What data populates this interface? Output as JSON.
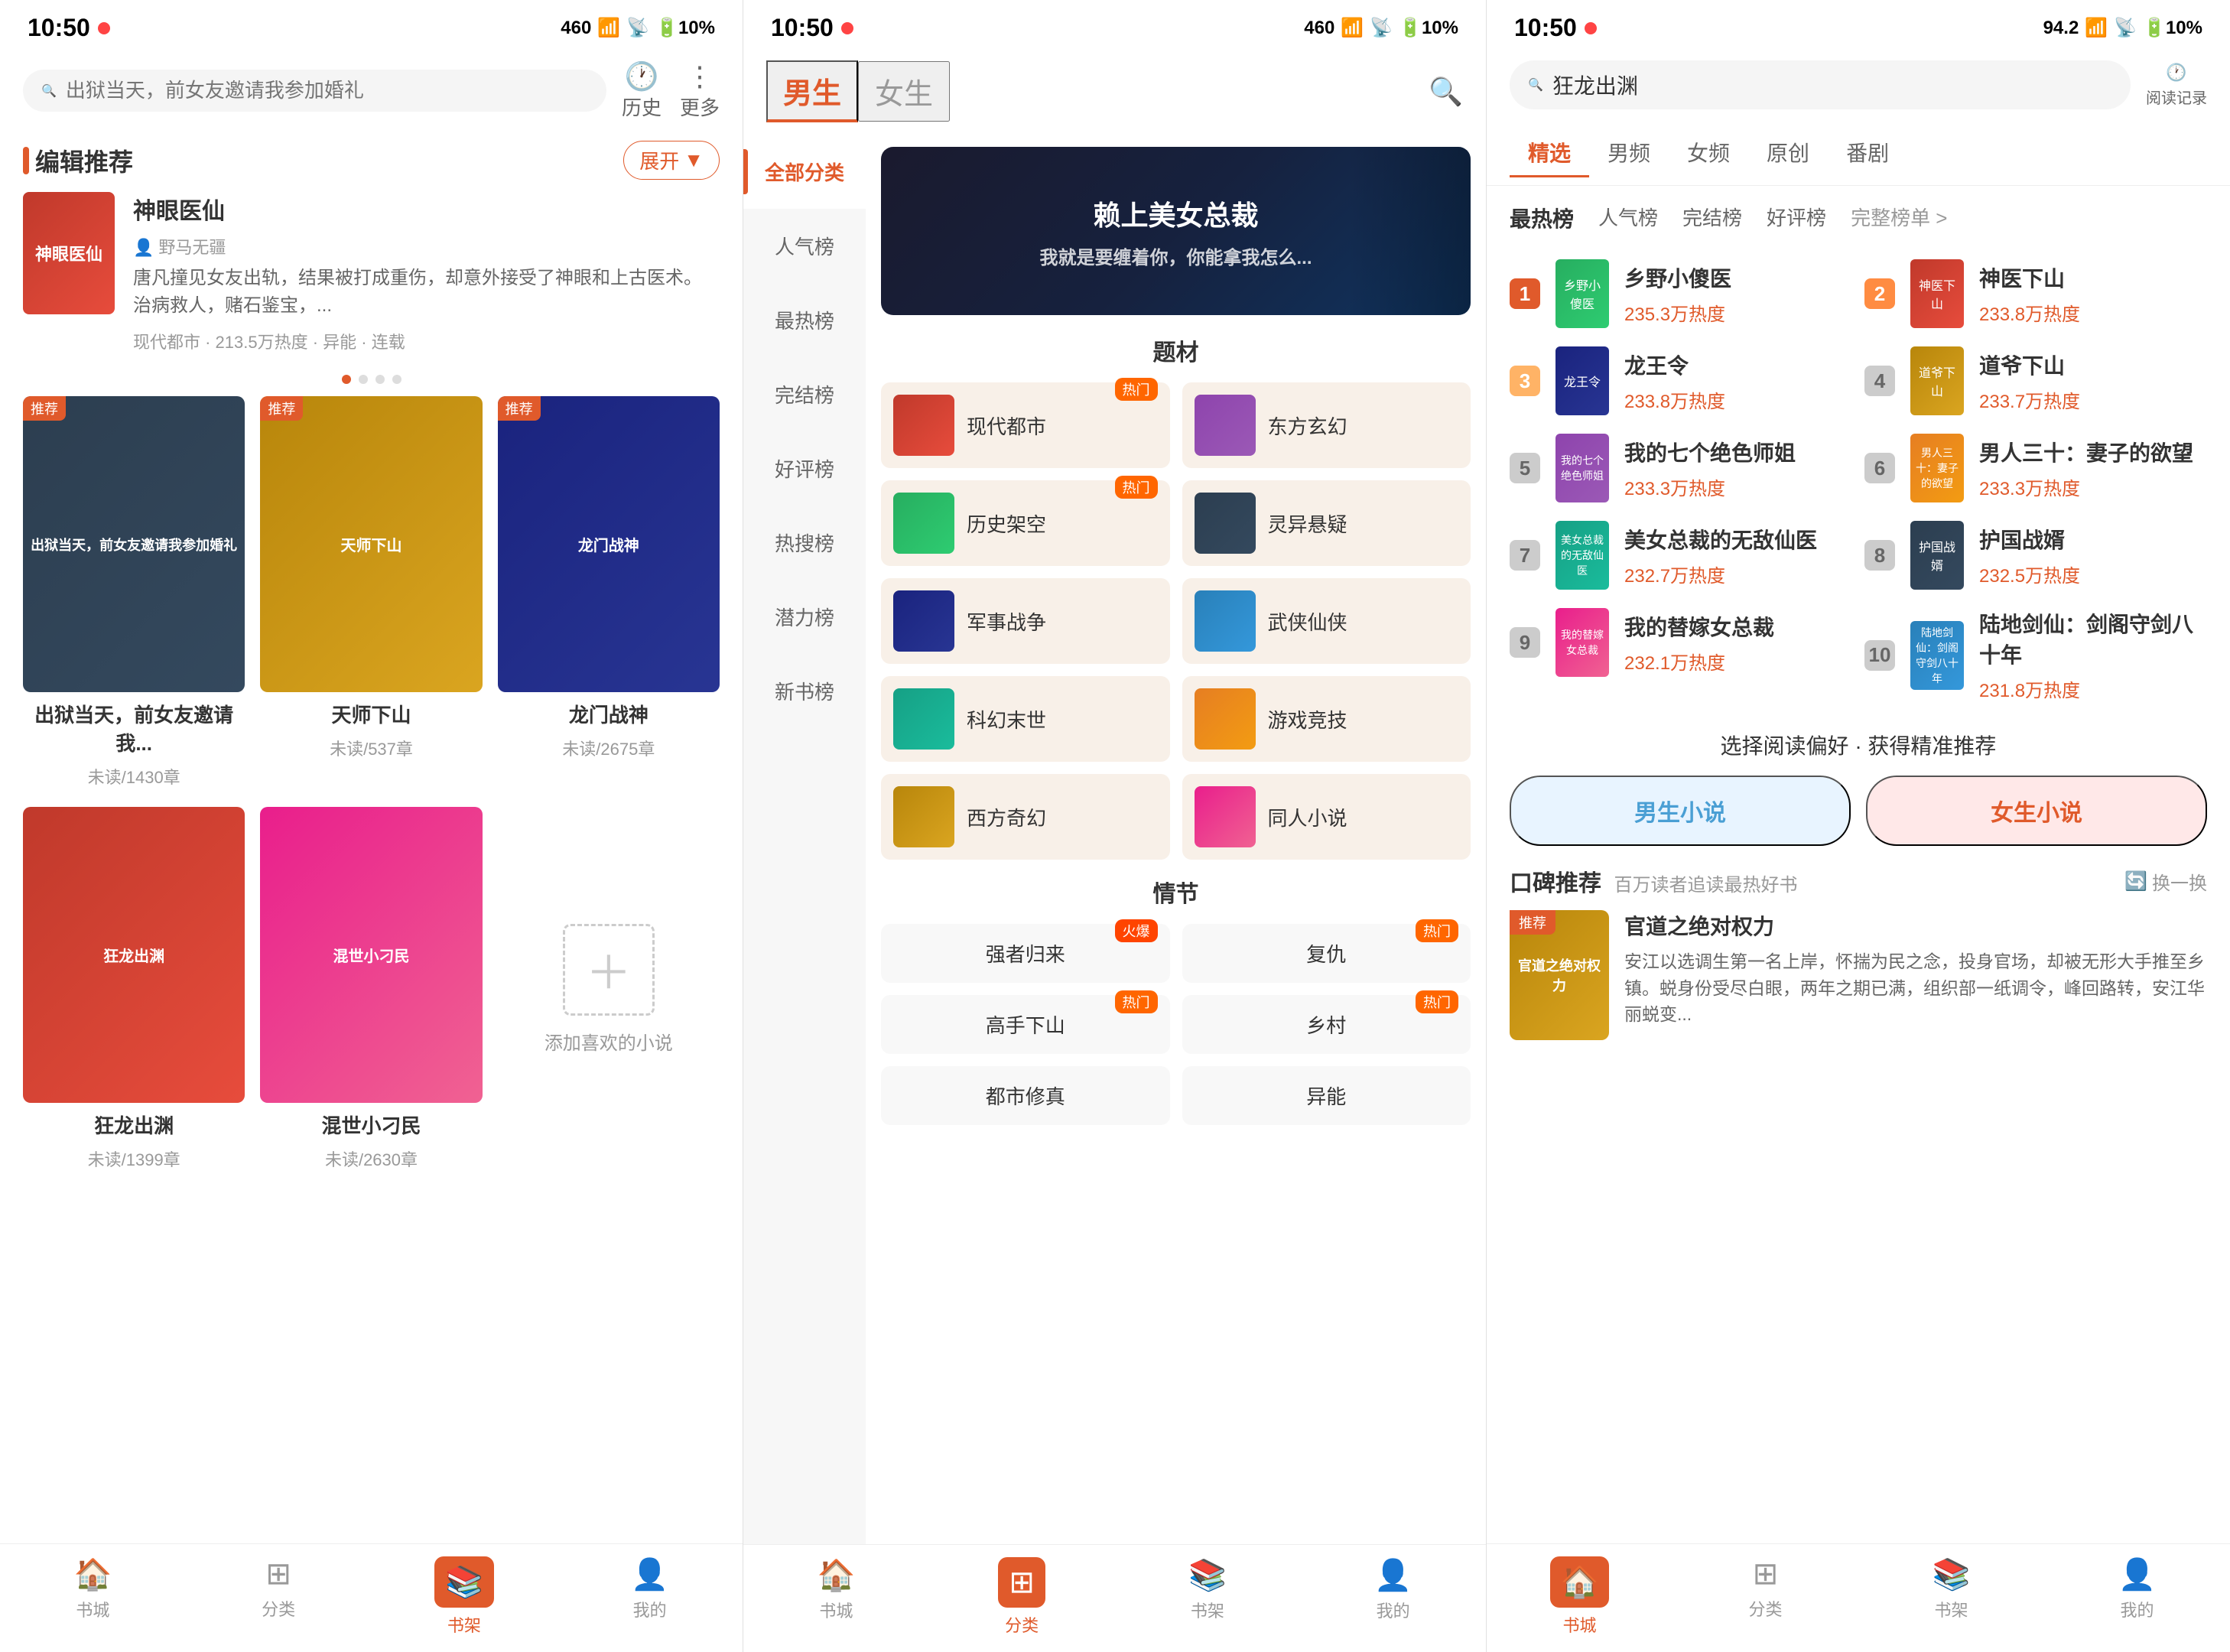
{
  "screens": [
    {
      "id": "screen1",
      "statusBar": {
        "time": "10:50",
        "dot": true
      },
      "search": {
        "placeholder": "出狱当天，前女友邀请我参加婚礼",
        "historyLabel": "历史",
        "moreLabel": "更多"
      },
      "editorRecommend": {
        "title": "编辑推荐",
        "expandLabel": "展开",
        "featuredBook": {
          "title": "神眼医仙",
          "tag": "野马无疆",
          "desc": "唐凡撞见女友出轨，结果被打成重伤，却意外接受了神眼和上古医术。治病救人，赌石鉴宝，...",
          "genre": "现代都市 · 213.5万热度 · 异能 · 连载"
        },
        "carouselBooks": [
          {
            "title": "出狱当天，前女友邀请我参加婚礼",
            "chapters": "未读/1430章",
            "coverClass": "cover-dark",
            "badge": "推荐"
          },
          {
            "title": "天师下山",
            "chapters": "未读/537章",
            "coverClass": "cover-gold",
            "badge": "推荐"
          },
          {
            "title": "龙门战神",
            "chapters": "未读/2675章",
            "coverClass": "cover-navy",
            "badge": "推荐"
          }
        ],
        "row2Books": [
          {
            "title": "狂龙出渊",
            "chapters": "未读/1399章",
            "coverClass": "cover-red",
            "badge": ""
          },
          {
            "title": "混世小刁民",
            "chapters": "未读/2630章",
            "coverClass": "cover-pink",
            "badge": ""
          }
        ],
        "addLabel": "添加喜欢的小说"
      },
      "nav": [
        {
          "icon": "🏠",
          "label": "书城",
          "active": false
        },
        {
          "icon": "⊞",
          "label": "分类",
          "active": false
        },
        {
          "icon": "📚",
          "label": "书架",
          "active": true
        },
        {
          "icon": "👤",
          "label": "我的",
          "active": false
        }
      ]
    },
    {
      "id": "screen2",
      "statusBar": {
        "time": "10:50",
        "dot": true
      },
      "tabs": [
        {
          "label": "男生",
          "active": true
        },
        {
          "label": "女生",
          "active": false
        }
      ],
      "sidebar": [
        {
          "label": "全部分类",
          "active": true
        },
        {
          "label": "人气榜",
          "active": false
        },
        {
          "label": "最热榜",
          "active": false
        },
        {
          "label": "完结榜",
          "active": false
        },
        {
          "label": "好评榜",
          "active": false
        },
        {
          "label": "热搜榜",
          "active": false
        },
        {
          "label": "潜力榜",
          "active": false
        },
        {
          "label": "新书榜",
          "active": false
        }
      ],
      "banner": {
        "text": "赖上美女总裁\n我就是要缠着你，你能拿我怎么..."
      },
      "categories": {
        "topicTitle": "题材",
        "items": [
          {
            "name": "现代都市",
            "hot": true,
            "coverClass": "cover-red"
          },
          {
            "name": "东方玄幻",
            "hot": false,
            "coverClass": "cover-purple"
          },
          {
            "name": "历史架空",
            "hot": true,
            "coverClass": "cover-green"
          },
          {
            "name": "灵异悬疑",
            "hot": false,
            "coverClass": "cover-dark"
          },
          {
            "name": "军事战争",
            "hot": false,
            "coverClass": "cover-navy"
          },
          {
            "name": "武侠仙侠",
            "hot": false,
            "coverClass": "cover-blue"
          },
          {
            "name": "科幻末世",
            "hot": false,
            "coverClass": "cover-teal"
          },
          {
            "name": "游戏竞技",
            "hot": false,
            "coverClass": "cover-orange"
          },
          {
            "name": "西方奇幻",
            "hot": false,
            "coverClass": "cover-gold"
          },
          {
            "name": "同人小说",
            "hot": false,
            "coverClass": "cover-pink"
          }
        ],
        "feelingTitle": "情节",
        "feelings": [
          {
            "name": "强者归来",
            "badge": "火爆"
          },
          {
            "name": "复仇",
            "badge": "热门"
          },
          {
            "name": "高手下山",
            "badge": "热门"
          },
          {
            "name": "乡村",
            "badge": "热门"
          },
          {
            "name": "都市修真",
            "badge": ""
          },
          {
            "name": "异能",
            "badge": ""
          }
        ]
      },
      "nav": [
        {
          "icon": "🏠",
          "label": "书城",
          "active": false
        },
        {
          "icon": "⊞",
          "label": "分类",
          "active": true
        },
        {
          "icon": "📚",
          "label": "书架",
          "active": false
        },
        {
          "icon": "👤",
          "label": "我的",
          "active": false
        }
      ]
    },
    {
      "id": "screen3",
      "statusBar": {
        "time": "10:50",
        "dot": true
      },
      "search": {
        "placeholder": "狂龙出渊",
        "historyLabel": "阅读记录"
      },
      "mainTabs": [
        {
          "label": "精选",
          "active": true
        },
        {
          "label": "男频",
          "active": false
        },
        {
          "label": "女频",
          "active": false
        },
        {
          "label": "原创",
          "active": false
        },
        {
          "label": "番剧",
          "active": false
        }
      ],
      "subTabs": [
        {
          "label": "最热榜",
          "active": true
        },
        {
          "label": "人气榜",
          "active": false
        },
        {
          "label": "完结榜",
          "active": false
        },
        {
          "label": "好评榜",
          "active": false
        },
        {
          "label": "完整榜单 >",
          "active": false,
          "special": true
        }
      ],
      "rankings": [
        {
          "rank": 1,
          "title": "乡野小傻医",
          "heat": "235.3万热度",
          "coverClass": "cover-green"
        },
        {
          "rank": 2,
          "title": "神医下山",
          "heat": "233.8万热度",
          "coverClass": "cover-red"
        },
        {
          "rank": 3,
          "title": "龙王令",
          "heat": "233.8万热度",
          "coverClass": "cover-navy"
        },
        {
          "rank": 4,
          "title": "道爷下山",
          "heat": "233.7万热度",
          "coverClass": "cover-gold"
        },
        {
          "rank": 5,
          "title": "我的七个绝色师姐",
          "heat": "233.3万热度",
          "coverClass": "cover-purple"
        },
        {
          "rank": 6,
          "title": "男人三十：妻子的欲望",
          "heat": "233.3万热度",
          "coverClass": "cover-orange"
        },
        {
          "rank": 7,
          "title": "美女总裁的无敌仙医",
          "heat": "232.7万热度",
          "coverClass": "cover-teal"
        },
        {
          "rank": 8,
          "title": "护国战婿",
          "heat": "232.5万热度",
          "coverClass": "cover-dark"
        },
        {
          "rank": 9,
          "title": "我的替嫁女总裁",
          "heat": "232.1万热度",
          "coverClass": "cover-pink"
        },
        {
          "rank": 10,
          "title": "陆地剑仙：剑阁守剑八十年",
          "heat": "231.8万热度",
          "coverClass": "cover-blue"
        }
      ],
      "preference": {
        "title": "选择阅读偏好 · 获得精准推荐",
        "maleLabel": "男生小说",
        "femaleLabel": "女生小说"
      },
      "wordOfMouth": {
        "title": "口碑推荐",
        "subtitle": "百万读者追读最热好书",
        "actionLabel": "换一换",
        "book": {
          "title": "官道之绝对权力",
          "coverClass": "cover-gold",
          "badge": "推荐",
          "desc": "安江以选调生第一名上岸，怀揣为民之念，投身官场，却被无形大手推至乡镇。蜕身份受尽白眼，两年之期已满，组织部一纸调令，峰回路转，安江华丽蜕变..."
        }
      },
      "nav": [
        {
          "icon": "🏠",
          "label": "书城",
          "active": true
        },
        {
          "icon": "⊞",
          "label": "分类",
          "active": false
        },
        {
          "icon": "📚",
          "label": "书架",
          "active": false
        },
        {
          "icon": "👤",
          "label": "我的",
          "active": false
        }
      ]
    }
  ]
}
